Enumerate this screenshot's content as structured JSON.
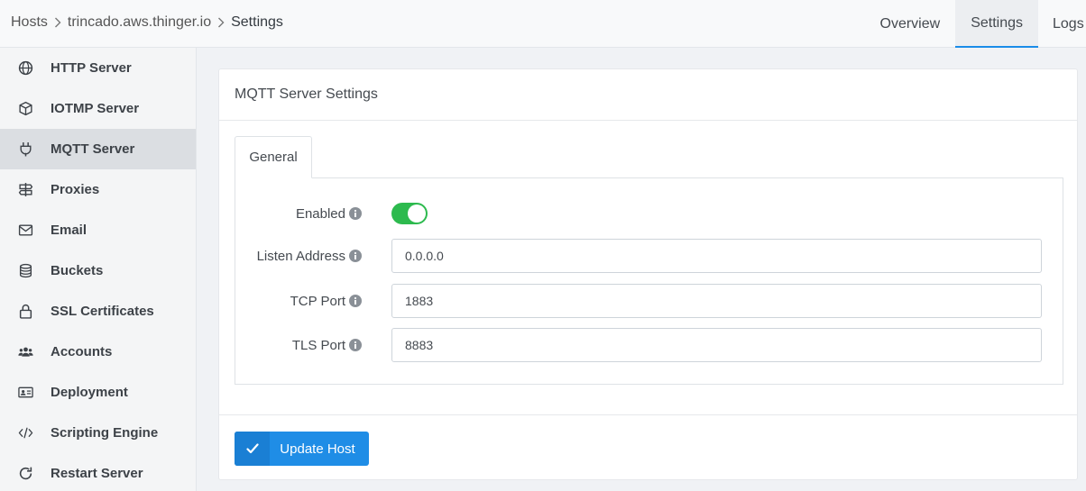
{
  "breadcrumb": {
    "items": [
      "Hosts",
      "trincado.aws.thinger.io"
    ],
    "current": "Settings"
  },
  "top_tabs": [
    {
      "label": "Overview",
      "active": false
    },
    {
      "label": "Settings",
      "active": true
    },
    {
      "label": "Logs",
      "active": false
    }
  ],
  "sidebar": {
    "items": [
      {
        "label": "HTTP Server",
        "icon": "globe-icon"
      },
      {
        "label": "IOTMP Server",
        "icon": "cube-icon"
      },
      {
        "label": "MQTT Server",
        "icon": "plug-icon",
        "active": true
      },
      {
        "label": "Proxies",
        "icon": "signpost-icon"
      },
      {
        "label": "Email",
        "icon": "envelope-icon"
      },
      {
        "label": "Buckets",
        "icon": "database-icon"
      },
      {
        "label": "SSL Certificates",
        "icon": "lock-icon"
      },
      {
        "label": "Accounts",
        "icon": "users-icon"
      },
      {
        "label": "Deployment",
        "icon": "id-card-icon"
      },
      {
        "label": "Scripting Engine",
        "icon": "code-icon"
      },
      {
        "label": "Restart Server",
        "icon": "redo-icon"
      }
    ]
  },
  "card": {
    "title": "MQTT Server Settings",
    "tab": "General",
    "fields": {
      "enabled_label": "Enabled",
      "enabled_value": true,
      "listen_address_label": "Listen Address",
      "listen_address_value": "0.0.0.0",
      "tcp_port_label": "TCP Port",
      "tcp_port_value": "1883",
      "tls_port_label": "TLS Port",
      "tls_port_value": "8883"
    },
    "button_label": "Update Host"
  },
  "colors": {
    "accent": "#1f8de6",
    "toggle_on": "#2dba4e"
  }
}
